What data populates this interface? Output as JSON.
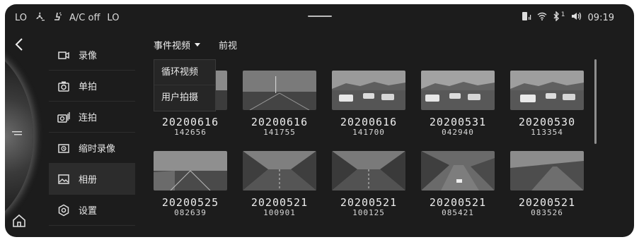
{
  "status_bar": {
    "left_temp": "LO",
    "ac_text": "A/C off",
    "right_temp": "LO",
    "bluetooth_superscript": "1",
    "time": "09:19"
  },
  "menu": {
    "items": [
      {
        "label": "录像",
        "icon": "video-camera-icon"
      },
      {
        "label": "单拍",
        "icon": "camera-icon"
      },
      {
        "label": "连拍",
        "icon": "burst-camera-icon"
      },
      {
        "label": "缩时录像",
        "icon": "timelapse-icon"
      },
      {
        "label": "相册",
        "icon": "gallery-icon",
        "active": true
      },
      {
        "label": "设置",
        "icon": "gear-icon"
      }
    ]
  },
  "tabs": {
    "dropdown_label": "事件视频",
    "second_label": "前视"
  },
  "dropdown_options": [
    "循环视频",
    "用户拍摄"
  ],
  "gallery": {
    "items": [
      {
        "date": "20200616",
        "time": "142656"
      },
      {
        "date": "20200616",
        "time": "141755"
      },
      {
        "date": "20200616",
        "time": "141700"
      },
      {
        "date": "20200531",
        "time": "042940"
      },
      {
        "date": "20200530",
        "time": "113354"
      },
      {
        "date": "20200525",
        "time": "082639"
      },
      {
        "date": "20200521",
        "time": "100901"
      },
      {
        "date": "20200521",
        "time": "100125"
      },
      {
        "date": "20200521",
        "time": "085421"
      },
      {
        "date": "20200521",
        "time": "083526"
      }
    ]
  }
}
